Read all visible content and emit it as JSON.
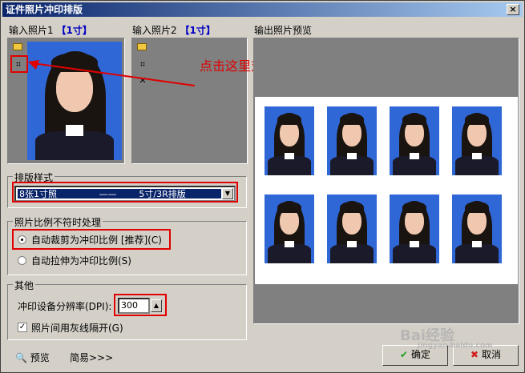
{
  "window": {
    "title": "证件照片冲印排版",
    "close_glyph": "×"
  },
  "input1": {
    "label": "输入照片1",
    "size": "【1寸】"
  },
  "input2": {
    "label": "输入照片2",
    "size": "【1寸】"
  },
  "output": {
    "label": "输出照片预览",
    "columns": 4,
    "rows": 2
  },
  "annotation": {
    "text": "点击这里对照片进行裁剪",
    "color": "#e00000"
  },
  "layout_group": {
    "title": "排版样式",
    "selected": "8张1寸照               ——        5寸/3R排版"
  },
  "ratio_group": {
    "title": "照片比例不符时处理",
    "options": [
      {
        "label": "自动裁剪为冲印比例 [推荐](C)",
        "selected": true
      },
      {
        "label": "自动拉伸为冲印比例(S)",
        "selected": false
      }
    ]
  },
  "other_group": {
    "title": "其他",
    "dpi_label": "冲印设备分辨率(DPI):",
    "dpi_value": "300",
    "gray_line_label": "照片间用灰线隔开(G)",
    "gray_line_checked": true
  },
  "footer": {
    "preview_label": "预览",
    "simple_label": "简易>>>",
    "ok_label": "确定",
    "cancel_label": "取消"
  },
  "watermark": {
    "text": "Bai经验",
    "sub": "jingyan.baidu.com"
  },
  "colors": {
    "photo_bg": "#2f67d6",
    "title_bar": "#0a246a",
    "highlight": "#e00000"
  }
}
